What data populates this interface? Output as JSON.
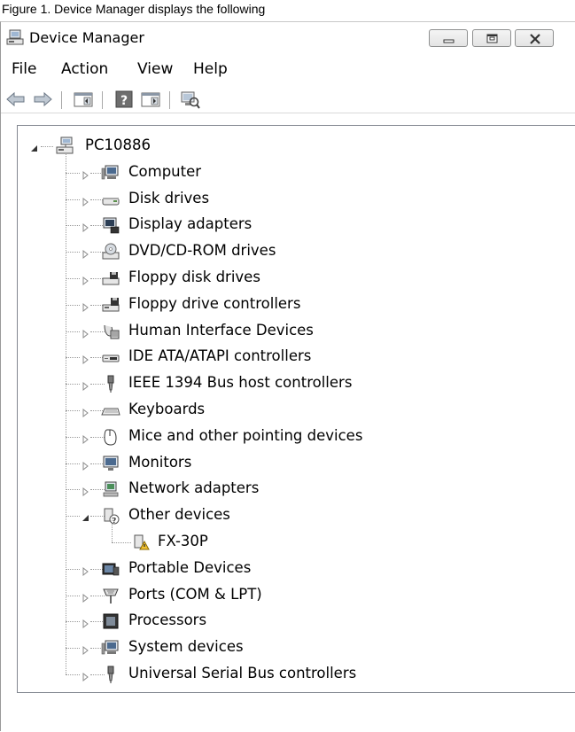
{
  "caption": "Figure 1. Device Manager displays the following",
  "window": {
    "title": "Device Manager",
    "buttons": {
      "minimize": "minimize-icon",
      "maximize": "maximize-icon",
      "close": "close-icon"
    }
  },
  "menu": [
    {
      "label": "File"
    },
    {
      "label": "Action"
    },
    {
      "label": "View"
    },
    {
      "label": "Help"
    }
  ],
  "toolbar": [
    "back-arrow-icon",
    "forward-arrow-icon",
    "console-tree-icon",
    "help-icon",
    "action-pane-icon",
    "scan-hardware-icon"
  ],
  "tree": {
    "root": {
      "label": "PC10886",
      "icon": "computer-network-icon",
      "expanded": true
    },
    "items": [
      {
        "label": "Computer",
        "icon": "computer-icon",
        "expanded": false,
        "children": []
      },
      {
        "label": "Disk drives",
        "icon": "disk-drive-icon",
        "expanded": false,
        "children": []
      },
      {
        "label": "Display adapters",
        "icon": "display-adapter-icon",
        "expanded": false,
        "children": []
      },
      {
        "label": "DVD/CD-ROM drives",
        "icon": "dvd-drive-icon",
        "expanded": false,
        "children": []
      },
      {
        "label": "Floppy disk drives",
        "icon": "floppy-drive-icon",
        "expanded": false,
        "children": []
      },
      {
        "label": "Floppy drive controllers",
        "icon": "floppy-controller-icon",
        "expanded": false,
        "children": []
      },
      {
        "label": "Human Interface Devices",
        "icon": "hid-icon",
        "expanded": false,
        "children": []
      },
      {
        "label": "IDE ATA/ATAPI controllers",
        "icon": "ide-controller-icon",
        "expanded": false,
        "children": []
      },
      {
        "label": "IEEE 1394 Bus host controllers",
        "icon": "ieee1394-icon",
        "expanded": false,
        "children": []
      },
      {
        "label": "Keyboards",
        "icon": "keyboard-icon",
        "expanded": false,
        "children": []
      },
      {
        "label": "Mice and other pointing devices",
        "icon": "mouse-icon",
        "expanded": false,
        "children": []
      },
      {
        "label": "Monitors",
        "icon": "monitor-icon",
        "expanded": false,
        "children": []
      },
      {
        "label": "Network adapters",
        "icon": "network-adapter-icon",
        "expanded": false,
        "children": []
      },
      {
        "label": "Other devices",
        "icon": "unknown-device-icon",
        "expanded": true,
        "children": [
          {
            "label": "FX-30P",
            "icon": "unknown-device-warning-icon"
          }
        ]
      },
      {
        "label": "Portable Devices",
        "icon": "portable-device-icon",
        "expanded": false,
        "children": []
      },
      {
        "label": "Ports (COM & LPT)",
        "icon": "port-icon",
        "expanded": false,
        "children": []
      },
      {
        "label": "Processors",
        "icon": "processor-icon",
        "expanded": false,
        "children": []
      },
      {
        "label": "System devices",
        "icon": "system-device-icon",
        "expanded": false,
        "children": []
      },
      {
        "label": "Universal Serial Bus controllers",
        "icon": "usb-icon",
        "expanded": false,
        "children": []
      }
    ]
  },
  "colors": {
    "tree_border": "#828790",
    "dotted_lines": "#9a9a9a",
    "window_bg": "#ffffff"
  }
}
